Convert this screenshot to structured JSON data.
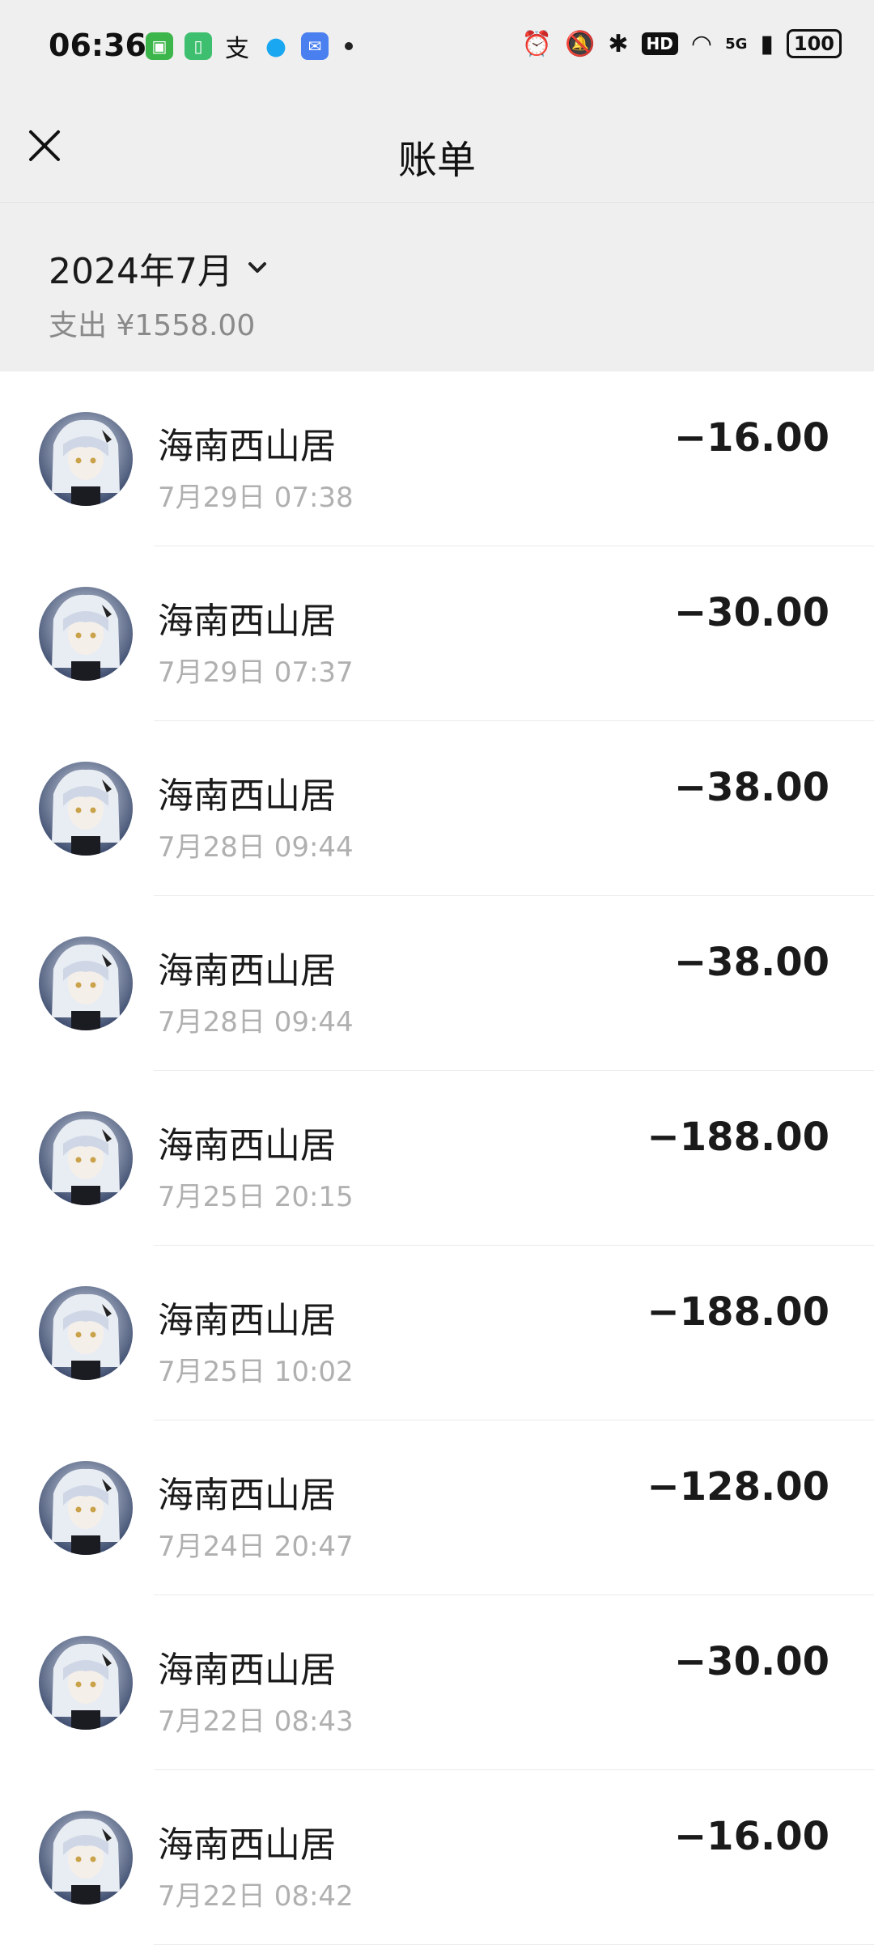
{
  "status_bar": {
    "time": "06:36",
    "signal_label": "5G",
    "hd_label": "HD",
    "battery": "100"
  },
  "nav": {
    "title": "账单"
  },
  "month": {
    "label": "2024年7月",
    "summary": "支出 ¥1558.00"
  },
  "transactions": [
    {
      "merchant": "海南西山居",
      "datetime": "7月29日 07:38",
      "amount": "−16.00"
    },
    {
      "merchant": "海南西山居",
      "datetime": "7月29日 07:37",
      "amount": "−30.00"
    },
    {
      "merchant": "海南西山居",
      "datetime": "7月28日 09:44",
      "amount": "−38.00"
    },
    {
      "merchant": "海南西山居",
      "datetime": "7月28日 09:44",
      "amount": "−38.00"
    },
    {
      "merchant": "海南西山居",
      "datetime": "7月25日 20:15",
      "amount": "−188.00"
    },
    {
      "merchant": "海南西山居",
      "datetime": "7月25日 10:02",
      "amount": "−188.00"
    },
    {
      "merchant": "海南西山居",
      "datetime": "7月24日 20:47",
      "amount": "−128.00"
    },
    {
      "merchant": "海南西山居",
      "datetime": "7月22日 08:43",
      "amount": "−30.00"
    },
    {
      "merchant": "海南西山居",
      "datetime": "7月22日 08:42",
      "amount": "−16.00"
    }
  ]
}
